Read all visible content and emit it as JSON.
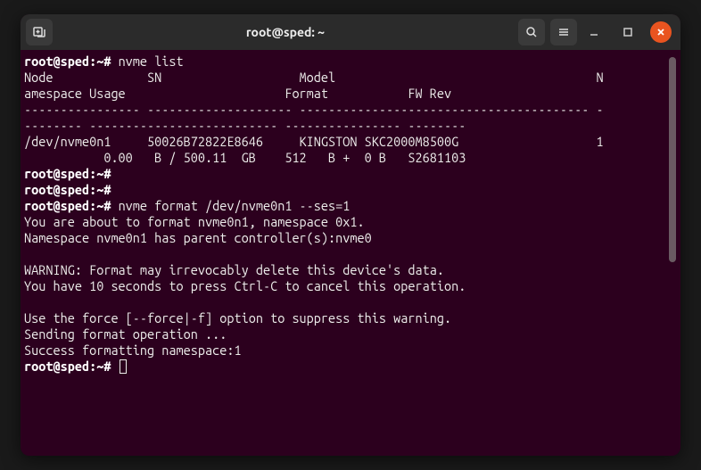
{
  "window": {
    "title": "root@sped: ~"
  },
  "terminal": {
    "lines": [
      {
        "type": "cmd",
        "prompt": "root@sped",
        "path": "~",
        "sep": "#",
        "command": "nvme list"
      },
      {
        "type": "out",
        "text": "Node             SN                   Model                                    N"
      },
      {
        "type": "out",
        "text": "amespace Usage                      Format           FW Rev"
      },
      {
        "type": "out",
        "text": "---------------- -------------------- ---------------------------------------- -"
      },
      {
        "type": "out",
        "text": "-------- -------------------------- ---------------- --------"
      },
      {
        "type": "out",
        "text": "/dev/nvme0n1     50026B72822E8646     KINGSTON SKC2000M8500G                   1"
      },
      {
        "type": "out",
        "text": "           0.00   B / 500.11  GB    512   B +  0 B   S2681103"
      },
      {
        "type": "cmd",
        "prompt": "root@sped",
        "path": "~",
        "sep": "#",
        "command": ""
      },
      {
        "type": "cmd",
        "prompt": "root@sped",
        "path": "~",
        "sep": "#",
        "command": ""
      },
      {
        "type": "cmd",
        "prompt": "root@sped",
        "path": "~",
        "sep": "#",
        "command": "nvme format /dev/nvme0n1 --ses=1"
      },
      {
        "type": "out",
        "text": "You are about to format nvme0n1, namespace 0x1."
      },
      {
        "type": "out",
        "text": "Namespace nvme0n1 has parent controller(s):nvme0"
      },
      {
        "type": "out",
        "text": ""
      },
      {
        "type": "out",
        "text": "WARNING: Format may irrevocably delete this device's data."
      },
      {
        "type": "out",
        "text": "You have 10 seconds to press Ctrl-C to cancel this operation."
      },
      {
        "type": "out",
        "text": ""
      },
      {
        "type": "out",
        "text": "Use the force [--force|-f] option to suppress this warning."
      },
      {
        "type": "out",
        "text": "Sending format operation ..."
      },
      {
        "type": "out",
        "text": "Success formatting namespace:1"
      },
      {
        "type": "cmd",
        "prompt": "root@sped",
        "path": "~",
        "sep": "#",
        "command": "",
        "cursor": true
      }
    ]
  }
}
